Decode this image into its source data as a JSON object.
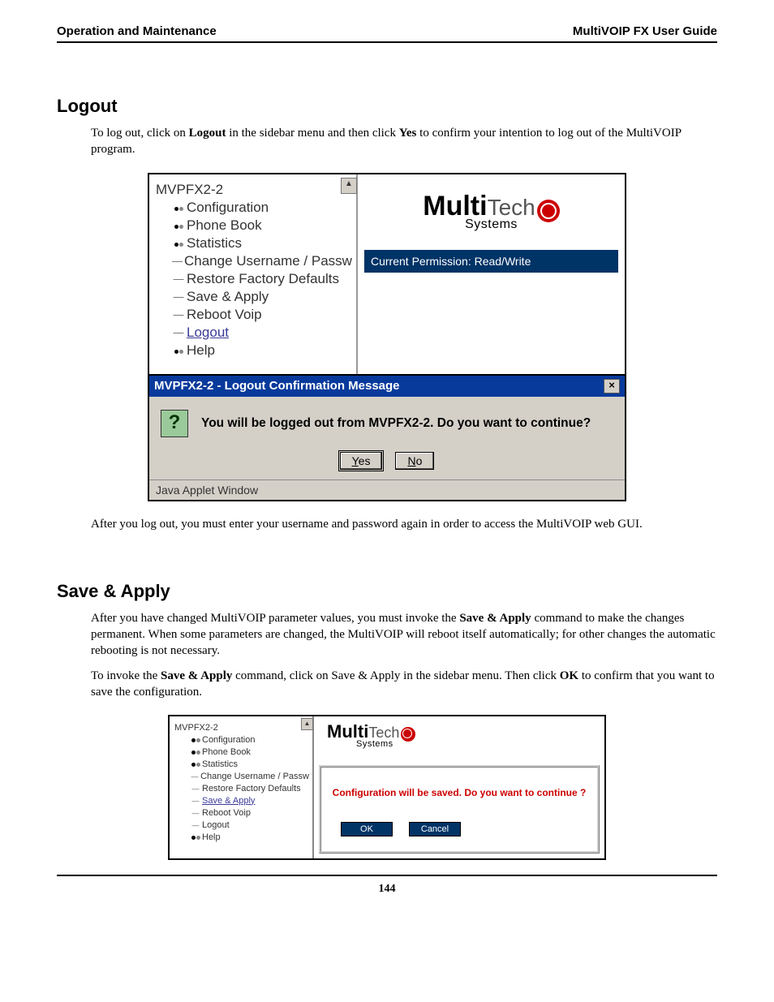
{
  "header": {
    "left": "Operation and Maintenance",
    "right": "MultiVOIP FX User Guide"
  },
  "section1": {
    "title": "Logout",
    "para1_a": "To log out, click on ",
    "para1_b": "Logout",
    "para1_c": " in the sidebar menu and then click ",
    "para1_d": "Yes",
    "para1_e": " to confirm your intention to log out of the MultiVOIP program.",
    "para2": "After you log out, you must enter your username and password again in order to access the MultiVOIP web GUI."
  },
  "section2": {
    "title": "Save & Apply",
    "para1_a": "After you have changed MultiVOIP parameter values, you must invoke the ",
    "para1_b": "Save & Apply",
    "para1_c": " command to make the changes permanent.  When some parameters are changed, the MultiVOIP will reboot itself automatically;  for other changes the automatic rebooting is not necessary.",
    "para2_a": "To invoke the ",
    "para2_b": "Save & Apply",
    "para2_c": " command, click on Save & Apply in the sidebar menu.  Then click ",
    "para2_d": "OK",
    "para2_e": " to confirm that you want to save the configuration."
  },
  "tree": {
    "root": "MVPFX2-2",
    "items": [
      "Configuration",
      "Phone Book",
      "Statistics",
      "Change Username / Passw",
      "Restore Factory Defaults",
      "Save & Apply",
      "Reboot Voip",
      "Logout",
      "Help"
    ]
  },
  "logo": {
    "multi": "Multi",
    "tech": "Tech",
    "systems": "Systems"
  },
  "fig1": {
    "permission": "Current Permission:  Read/Write",
    "titlebar": "MVPFX2-2 -  Logout Confirmation Message",
    "qmark": "?",
    "message": "You will be logged out from MVPFX2-2. Do you want to continue?",
    "yes_u": "Y",
    "yes_rest": "es",
    "no_u": "N",
    "no_rest": "o",
    "status": "Java Applet Window",
    "close": "×",
    "scroll": "▲"
  },
  "fig2": {
    "warn": "Configuration will be saved. Do you want to continue ?",
    "ok": "OK",
    "cancel": "Cancel",
    "scroll": "▲"
  },
  "page_number": "144"
}
